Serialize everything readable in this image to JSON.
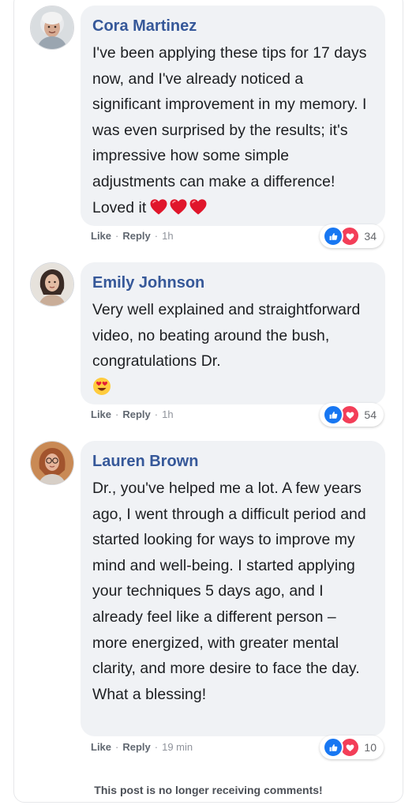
{
  "colors": {
    "author": "#365899",
    "bubble": "#f0f2f5",
    "like_blue": "#1877f2",
    "love_red": "#f33e58"
  },
  "comments": [
    {
      "author": "Cora Martinez",
      "text": "I've been applying these tips for 17 days now, and I've already noticed a significant improvement in my memory. I was even surprised by the results; it's impressive how some simple adjustments can make a difference! Loved it",
      "emojis": [
        "red-heart-icon",
        "red-heart-icon",
        "red-heart-icon"
      ],
      "like_label": "Like",
      "reply_label": "Reply",
      "time": "1h",
      "reaction_count": "34"
    },
    {
      "author": "Emily Johnson",
      "text": "Very well explained and straightforward video, no beating around the bush, congratulations Dr.",
      "emojis": [
        "heart-eyes-emoji-icon"
      ],
      "like_label": "Like",
      "reply_label": "Reply",
      "time": "1h",
      "reaction_count": "54"
    },
    {
      "author": "Lauren Brown",
      "text": "Dr., you've helped me a lot. A few years ago, I went through a difficult period and started looking for ways to improve my mind and well-being. I started applying your techniques 5 days ago, and I already feel like a different person – more energized, with greater mental clarity, and more desire to face the day. What a blessing!",
      "emojis": [],
      "like_label": "Like",
      "reply_label": "Reply",
      "time": "19 min",
      "reaction_count": "10"
    }
  ],
  "footer": {
    "notice": "This post is no longer receiving comments!"
  }
}
